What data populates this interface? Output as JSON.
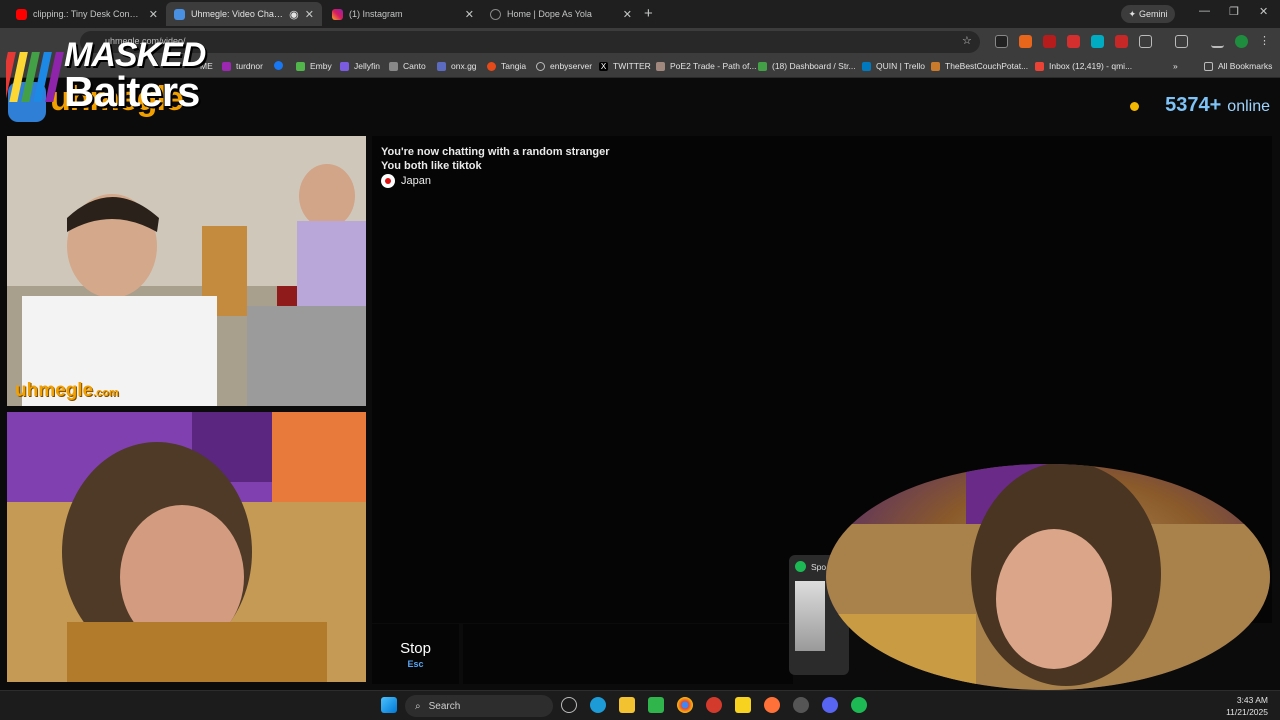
{
  "tabs": [
    {
      "label": "clipping.: Tiny Desk Concert - Y",
      "active": false
    },
    {
      "label": "Uhmegle: Video Chat | Ran",
      "active": true
    },
    {
      "label": "(1) Instagram",
      "active": false
    },
    {
      "label": "Home | Dope As Yola",
      "active": false
    }
  ],
  "gemini_label": "Gemini",
  "address": "uhmegle.com/video/",
  "bookmarks": [
    "ME",
    "turdnor",
    "Emby",
    "Jellyfin",
    "Canto",
    "onx.gg",
    "Tangia",
    "enbyserver",
    "TWITTER",
    "PoE2 Trade - Path of...",
    "(18) Dashboard / Str...",
    "QUIN | Trello",
    "TheBestCouchPotat...",
    "Inbox (12,419) - qmi...",
    "All Bookmarks"
  ],
  "site": {
    "logo": "uhmegle",
    "online_count": "5374+",
    "online_label": "online"
  },
  "watermark": {
    "name": "uhmegle",
    "tld": ".com"
  },
  "chat": {
    "line1": "You're now chatting with a random stranger",
    "line2": "You both like tiktok",
    "country": "Japan"
  },
  "stop": {
    "label": "Stop",
    "key": "Esc"
  },
  "spotify_title": "Spo",
  "overlay_logo": {
    "line1": "MASKED",
    "line2": "Baiters"
  },
  "taskbar": {
    "search_placeholder": "Search",
    "time": "3:43 AM",
    "date": "11/21/2025"
  },
  "colors": {
    "brand_orange": "#f2a000",
    "online_blue": "#7ec3f7",
    "esc_blue": "#57a5f2"
  }
}
